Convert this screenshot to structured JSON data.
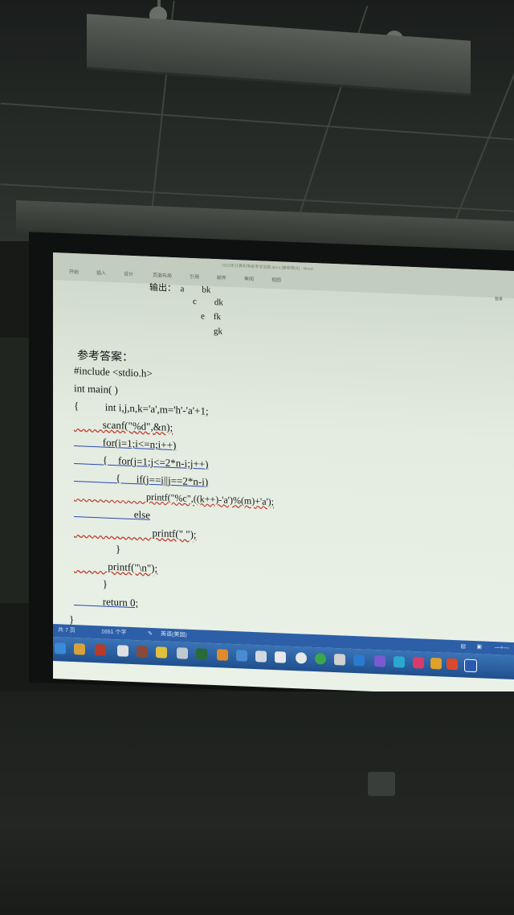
{
  "ribbon": {
    "title": "2015年计算机等级考试试题.docx [兼容模式] - Word",
    "tabs": [
      "开始",
      "插入",
      "设计",
      "页面布局",
      "引用",
      "邮件",
      "审阅",
      "视图"
    ],
    "mode": "登录"
  },
  "document": {
    "pattern_lines": [
      "输出：  a        bk",
      "c        dk",
      "e    fk",
      "gk"
    ],
    "answer_heading": "参考答案：",
    "code_lines": [
      "#include <stdio.h>",
      "int main( )",
      "{          int i,j,n,k='a',m='h'-'a'+1;",
      "           scanf(\"%d\",&n);",
      "           for(i=1;i<=n;i++)",
      "           {    for(j=1;j<=2*n-i;j++)",
      "                {      if(j==i||j==2*n-i)",
      "                              printf(\"%c\",((k++)-'a')%(m)+'a');",
      "                       else",
      "                              printf(\" \");",
      "                }",
      "             printf(\"\\n\");",
      "           }",
      "           return 0;",
      "}"
    ]
  },
  "statusbar": {
    "page": "共 7 页",
    "words": "1651 个字",
    "language": "英语(美国)"
  },
  "colors": {
    "taskbar": "#2c5fa8",
    "spellcheck_underline": "#c23a2e",
    "grammar_underline": "#2848b0"
  }
}
